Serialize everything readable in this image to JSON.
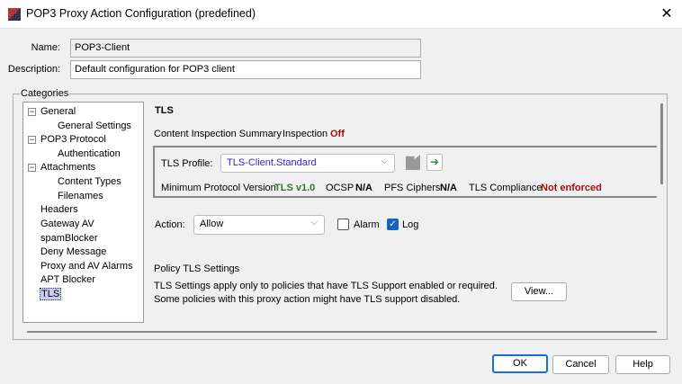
{
  "window": {
    "title": "POP3 Proxy Action Configuration (predefined)"
  },
  "form": {
    "name_label": "Name:",
    "name_value": "POP3-Client",
    "description_label": "Description:",
    "description_value": "Default configuration for POP3 client"
  },
  "categories": {
    "label": "Categories",
    "items": [
      {
        "label": "General"
      },
      {
        "label": "General Settings"
      },
      {
        "label": "POP3 Protocol"
      },
      {
        "label": "Authentication"
      },
      {
        "label": "Attachments"
      },
      {
        "label": "Content Types"
      },
      {
        "label": "Filenames"
      },
      {
        "label": "Headers"
      },
      {
        "label": "Gateway AV"
      },
      {
        "label": "spamBlocker"
      },
      {
        "label": "Deny Message"
      },
      {
        "label": "Proxy and AV Alarms"
      },
      {
        "label": "APT Blocker"
      },
      {
        "label": "TLS"
      }
    ]
  },
  "tls": {
    "heading": "TLS",
    "summary_label": "Content Inspection Summary",
    "inspection_label": "Inspection",
    "inspection_value": "Off",
    "profile_label": "TLS Profile:",
    "profile_value": "TLS-Client.Standard",
    "min_proto_label": "Minimum Protocol Version",
    "min_proto_value": "TLS v1.0",
    "ocsp_label": "OCSP",
    "ocsp_value": "N/A",
    "pfs_label": "PFS Ciphers",
    "pfs_value": "N/A",
    "compliance_label": "TLS Compliance",
    "compliance_value": "Not enforced",
    "action_label": "Action:",
    "action_value": "Allow",
    "alarm_label": "Alarm",
    "alarm_checked": false,
    "log_label": "Log",
    "log_checked": true,
    "policy_heading": "Policy TLS Settings",
    "policy_text1": "TLS Settings apply only to policies that have TLS Support enabled or required.",
    "policy_text2": "Some policies with this proxy action might have TLS support disabled.",
    "view_label": "View..."
  },
  "footer": {
    "ok": "OK",
    "cancel": "Cancel",
    "help": "Help"
  }
}
